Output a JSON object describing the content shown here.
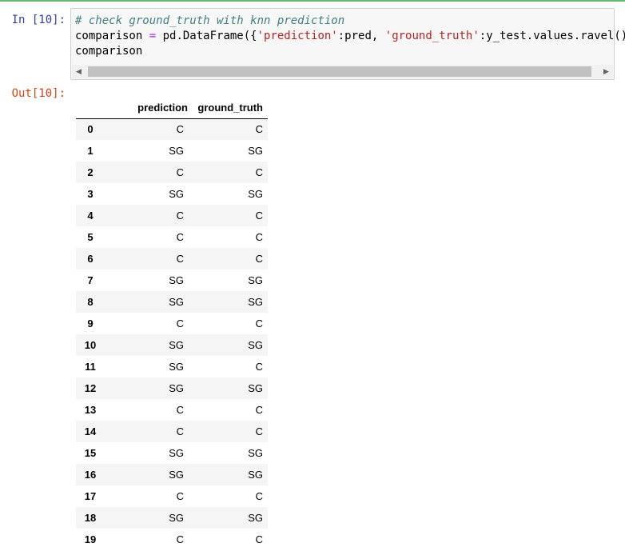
{
  "prompts": {
    "in": "In [10]:",
    "out": "Out[10]:"
  },
  "code": {
    "comment": "# check ground_truth with knn prediction",
    "line2_a": "comparison ",
    "line2_eq": "=",
    "line2_b": " pd.DataFrame({",
    "line2_s1": "'prediction'",
    "line2_c": ":pred, ",
    "line2_s2": "'ground_truth'",
    "line2_d": ":y_test.values.ravel()})",
    "line3": "comparison"
  },
  "scrollbar": {
    "left_icon": "scroll-left-arrow",
    "right_icon": "scroll-right-arrow"
  },
  "table": {
    "columns": [
      "",
      "prediction",
      "ground_truth"
    ],
    "rows": [
      {
        "index": "0",
        "prediction": "C",
        "ground_truth": "C"
      },
      {
        "index": "1",
        "prediction": "SG",
        "ground_truth": "SG"
      },
      {
        "index": "2",
        "prediction": "C",
        "ground_truth": "C"
      },
      {
        "index": "3",
        "prediction": "SG",
        "ground_truth": "SG"
      },
      {
        "index": "4",
        "prediction": "C",
        "ground_truth": "C"
      },
      {
        "index": "5",
        "prediction": "C",
        "ground_truth": "C"
      },
      {
        "index": "6",
        "prediction": "C",
        "ground_truth": "C"
      },
      {
        "index": "7",
        "prediction": "SG",
        "ground_truth": "SG"
      },
      {
        "index": "8",
        "prediction": "SG",
        "ground_truth": "SG"
      },
      {
        "index": "9",
        "prediction": "C",
        "ground_truth": "C"
      },
      {
        "index": "10",
        "prediction": "SG",
        "ground_truth": "SG"
      },
      {
        "index": "11",
        "prediction": "SG",
        "ground_truth": "C"
      },
      {
        "index": "12",
        "prediction": "SG",
        "ground_truth": "SG"
      },
      {
        "index": "13",
        "prediction": "C",
        "ground_truth": "C"
      },
      {
        "index": "14",
        "prediction": "C",
        "ground_truth": "C"
      },
      {
        "index": "15",
        "prediction": "SG",
        "ground_truth": "SG"
      },
      {
        "index": "16",
        "prediction": "SG",
        "ground_truth": "SG"
      },
      {
        "index": "17",
        "prediction": "C",
        "ground_truth": "C"
      },
      {
        "index": "18",
        "prediction": "SG",
        "ground_truth": "SG"
      },
      {
        "index": "19",
        "prediction": "C",
        "ground_truth": "C"
      }
    ]
  },
  "colors": {
    "in_prompt": "#303f9f",
    "out_prompt": "#d84315",
    "cell_border": "#66bb6a",
    "comment": "#408080",
    "string": "#ba2121"
  }
}
